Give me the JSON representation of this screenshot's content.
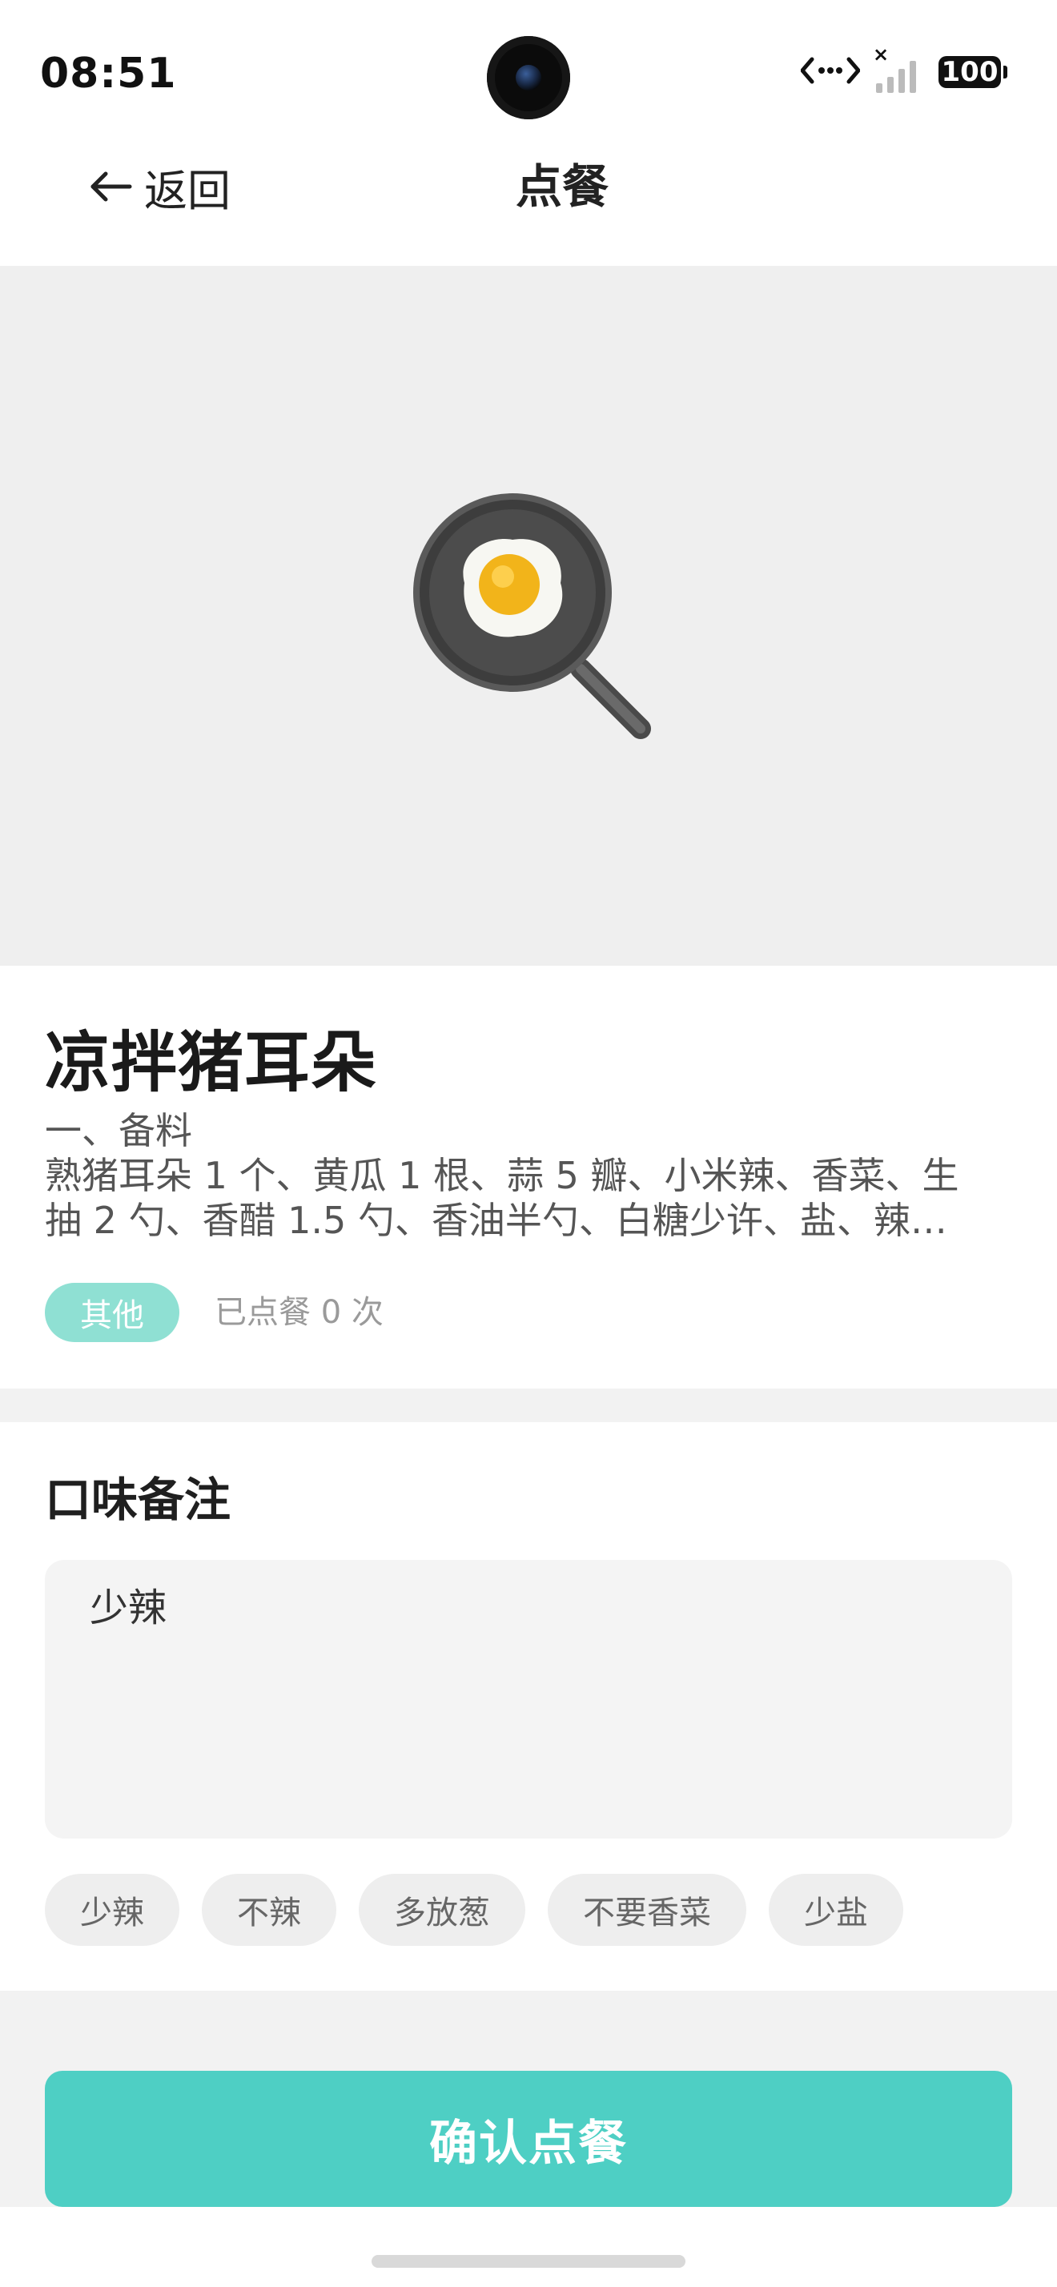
{
  "status_bar": {
    "time": "08:51",
    "battery": "100",
    "signal_icon": "signal-off-icon",
    "data_icon": "data-transfer-icon"
  },
  "nav": {
    "back_label": "返回",
    "title": "点餐"
  },
  "hero": {
    "icon": "frying-pan-egg-icon"
  },
  "dish": {
    "name": "凉拌猪耳朵",
    "description_lines": [
      "一、备料",
      "熟猪耳朵 1 个、黄瓜 1 根、蒜 5 瓣、小米辣、香菜、生",
      "抽 2 勺、香醋 1.5 勺、香油半勺、白糖少许、盐、辣…"
    ],
    "category_tag": "其他",
    "order_count_text": "已点餐 0 次"
  },
  "notes": {
    "title": "口味备注",
    "value": "少辣",
    "chips": [
      "少辣",
      "不辣",
      "多放葱",
      "不要香菜",
      "少盐"
    ]
  },
  "actions": {
    "confirm_label": "确认点餐"
  },
  "colors": {
    "accent": "#4ecfc4",
    "tag_bg": "#8fe0d3",
    "page_bg": "#f2f2f2",
    "hero_bg": "#efefef"
  }
}
